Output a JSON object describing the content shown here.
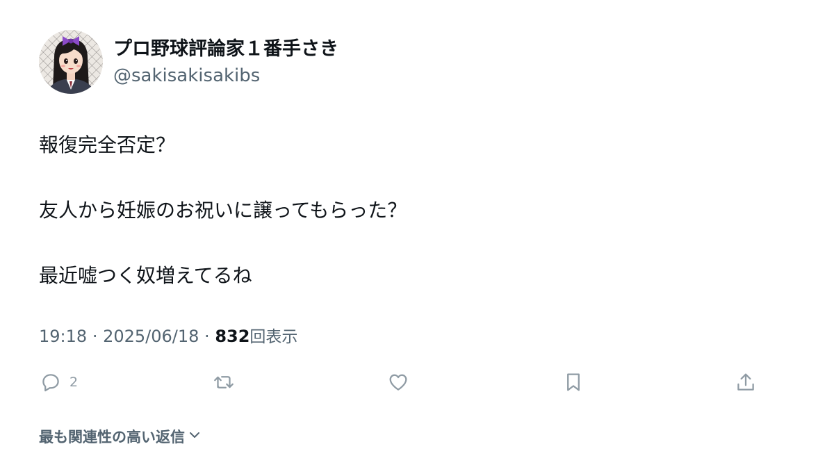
{
  "user": {
    "display_name": "プロ野球評論家１番手さき",
    "handle": "@sakisakisakibs",
    "avatar": "cartoon-girl-avatar"
  },
  "tweet": {
    "lines": [
      "報復完全否定？",
      "友人から妊娠のお祝いに譲ってもらった？",
      "最近嘘つく奴増えてるね"
    ],
    "time": "19:18",
    "separator": "·",
    "date": "2025/06/18",
    "views_count": "832",
    "views_label": "回表示"
  },
  "actions": {
    "reply_count": "2",
    "icons": [
      "reply-icon",
      "retweet-icon",
      "like-icon",
      "bookmark-icon",
      "share-icon"
    ]
  },
  "replies_sort": {
    "label": "最も関連性の高い返信"
  },
  "colors": {
    "text_primary": "#0f1419",
    "text_secondary": "#536471",
    "icon_gray": "#8f9ba4",
    "background": "#ffffff"
  }
}
